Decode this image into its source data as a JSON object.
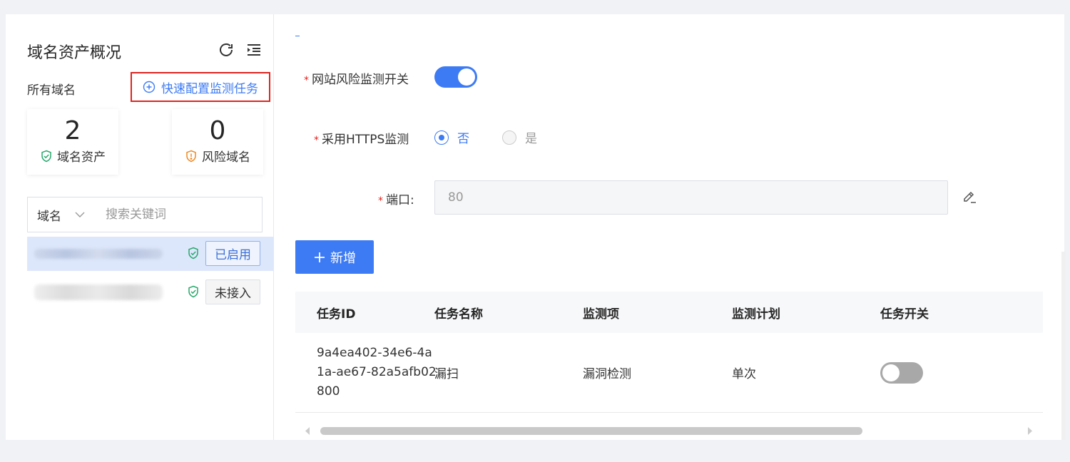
{
  "left": {
    "title": "域名资产概况",
    "subtitle": "所有域名",
    "quick_config": "快速配置监测任务",
    "stats": [
      {
        "value": "2",
        "label": "域名资产",
        "icon": "shield-check-icon",
        "color": "#29a86d"
      },
      {
        "value": "0",
        "label": "风险域名",
        "icon": "shield-alert-icon",
        "color": "#f08a24"
      }
    ],
    "search": {
      "select_value": "域名",
      "placeholder": "搜索关键词"
    },
    "domains": [
      {
        "status": "已启用",
        "selected": true
      },
      {
        "status": "未接入",
        "selected": false
      }
    ]
  },
  "form": {
    "risk_switch_label": "网站风险监测开关",
    "risk_switch_on": true,
    "https_label": "采用HTTPS监测",
    "https_options": [
      "否",
      "是"
    ],
    "https_selected": "否",
    "port_label": "端口:",
    "port_value": "80"
  },
  "add_button": "新增",
  "table": {
    "headers": [
      "任务ID",
      "任务名称",
      "监测项",
      "监测计划",
      "任务开关"
    ],
    "rows": [
      {
        "id": "9a4ea402-34e6-4a1a-ae67-82a5afb02800",
        "name": "漏扫",
        "item": "漏洞检测",
        "plan": "单次",
        "enabled": false
      }
    ]
  },
  "colors": {
    "primary": "#3d7bf4",
    "danger": "#e0241f",
    "success": "#29a86d",
    "warning": "#f08a24"
  }
}
